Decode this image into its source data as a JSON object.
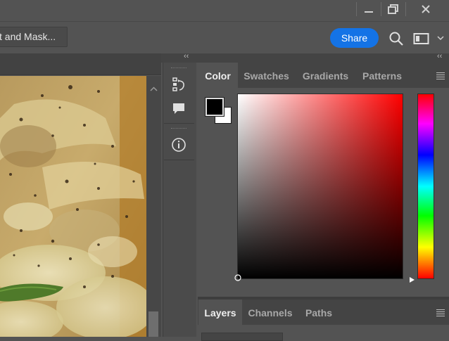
{
  "titlebar": {
    "icons": [
      "minimize-icon",
      "restore-icon",
      "close-icon"
    ]
  },
  "options_bar": {
    "mask_button_label": "t and Mask...",
    "share_label": "Share",
    "icons": [
      "search-icon",
      "workspace-icon",
      "chevron-down-icon"
    ]
  },
  "panel_strip": {
    "icons": [
      "history-icon",
      "comment-icon",
      "info-icon"
    ],
    "collapse_glyph": "‹‹"
  },
  "color_panel": {
    "tabs": [
      {
        "label": "Color",
        "active": true
      },
      {
        "label": "Swatches",
        "active": false
      },
      {
        "label": "Gradients",
        "active": false
      },
      {
        "label": "Patterns",
        "active": false
      }
    ],
    "foreground_color": "#000000",
    "background_color": "#ffffff"
  },
  "layers_panel": {
    "tabs": [
      {
        "label": "Layers",
        "active": true
      },
      {
        "label": "Channels",
        "active": false
      },
      {
        "label": "Paths",
        "active": false
      }
    ]
  },
  "colors": {
    "accent": "#1473e6",
    "ui_background": "#535353"
  }
}
